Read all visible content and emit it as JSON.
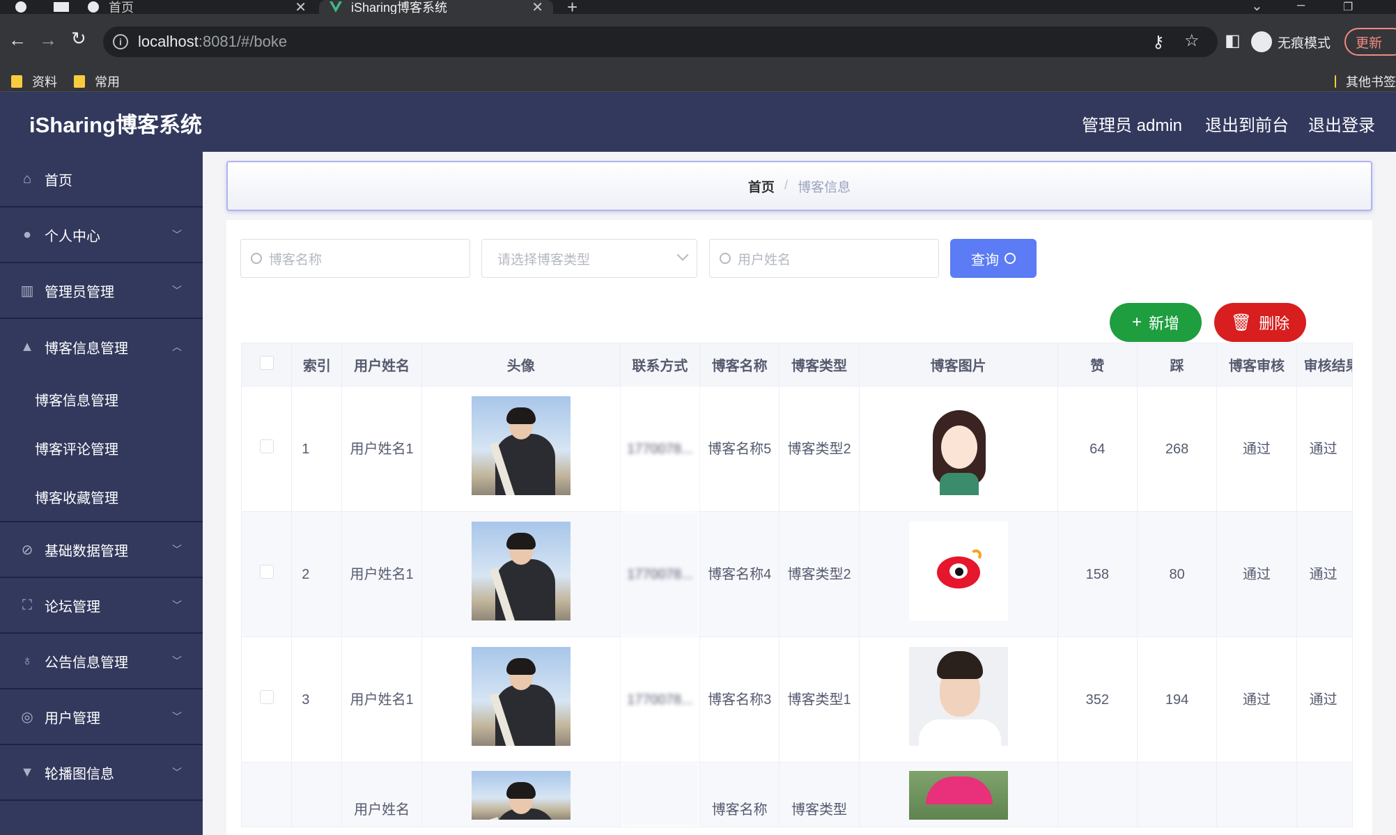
{
  "browser": {
    "tabs": [
      {
        "label": "首页"
      },
      {
        "label": "iSharing博客系统"
      }
    ],
    "new_tab": "+",
    "url_host": "localhost",
    "url_path": ":8081/#/boke",
    "incognito_label": "无痕模式",
    "update_label": "更新",
    "bookmarks": [
      {
        "label": "资料"
      },
      {
        "label": "常用"
      }
    ],
    "other_bookmarks": "其他书签"
  },
  "app": {
    "title": "iSharing博客系统",
    "header_links": {
      "admin": "管理员 admin",
      "to_front": "退出到前台",
      "logout": "退出登录"
    }
  },
  "sidebar": {
    "items": [
      {
        "label": "首页",
        "icon": "home-icon"
      },
      {
        "label": "个人中心",
        "icon": "user-icon"
      },
      {
        "label": "管理员管理",
        "icon": "books-icon"
      },
      {
        "label": "博客信息管理",
        "icon": "user-tie-icon"
      },
      {
        "label": "基础数据管理",
        "icon": "bell-off-icon"
      },
      {
        "label": "论坛管理",
        "icon": "frame-icon"
      },
      {
        "label": "公告信息管理",
        "icon": "microphone-icon"
      },
      {
        "label": "用户管理",
        "icon": "compass-icon"
      },
      {
        "label": "轮播图信息",
        "icon": "sign-icon"
      }
    ],
    "subitems": [
      {
        "label": "博客信息管理"
      },
      {
        "label": "博客评论管理"
      },
      {
        "label": "博客收藏管理"
      }
    ]
  },
  "breadcrumb": {
    "home": "首页",
    "separator": "/",
    "current": "博客信息"
  },
  "search": {
    "blog_name_placeholder": "博客名称",
    "blog_type_placeholder": "请选择博客类型",
    "user_name_placeholder": "用户姓名",
    "query_label": "查询"
  },
  "actions": {
    "add_label": "新增",
    "delete_label": "删除"
  },
  "table": {
    "columns": [
      "索引",
      "用户姓名",
      "头像",
      "联系方式",
      "博客名称",
      "博客类型",
      "博客图片",
      "赞",
      "踩",
      "博客审核",
      "审核结果"
    ],
    "rows": [
      {
        "index": "1",
        "user_name": "用户姓名1",
        "contact": "1770078...",
        "blog_name": "博客名称5",
        "blog_type": "博客类型2",
        "image": "girl-cartoon",
        "likes": "64",
        "dislikes": "268",
        "review": "通过",
        "result": "通过"
      },
      {
        "index": "2",
        "user_name": "用户姓名1",
        "contact": "1770078...",
        "blog_name": "博客名称4",
        "blog_type": "博客类型2",
        "image": "weibo-logo",
        "likes": "158",
        "dislikes": "80",
        "review": "通过",
        "result": "通过"
      },
      {
        "index": "3",
        "user_name": "用户姓名1",
        "contact": "1770078...",
        "blog_name": "博客名称3",
        "blog_type": "博客类型1",
        "image": "boy-portrait",
        "likes": "352",
        "dislikes": "194",
        "review": "通过",
        "result": "通过"
      },
      {
        "index": "",
        "user_name": "用户姓名",
        "contact": "",
        "blog_name": "博客名称",
        "blog_type": "博客类型",
        "image": "umbrella-photo",
        "likes": "",
        "dislikes": "",
        "review": "",
        "result": ""
      }
    ]
  },
  "colors": {
    "header_bg": "#33395d",
    "query_btn": "#5b7cf5",
    "add_btn": "#1e9e3f",
    "delete_btn": "#d81e1e"
  }
}
